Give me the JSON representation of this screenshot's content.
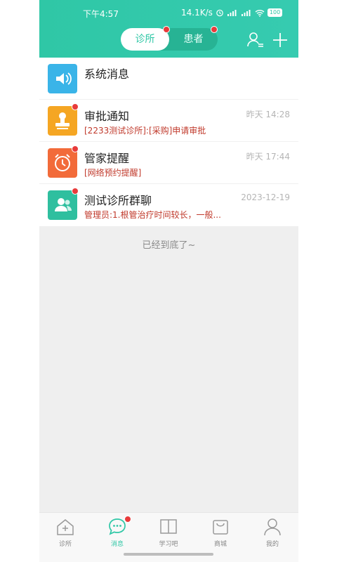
{
  "status": {
    "time": "下午4:57",
    "speed": "14.1K/s",
    "battery": "100"
  },
  "header": {
    "tabs": [
      {
        "label": "诊所",
        "active": true,
        "badge": true
      },
      {
        "label": "患者",
        "active": false,
        "badge": true
      }
    ],
    "icons": [
      "user-list-icon",
      "plus-icon"
    ],
    "accent": "#2fc7a6"
  },
  "messages": [
    {
      "title": "系统消息",
      "subtitle": "",
      "time": "",
      "icon": "speaker-icon",
      "color": "#3ab4e8",
      "badge": false
    },
    {
      "title": "审批通知",
      "subtitle": "[2233测试诊所]:[采购]申请审批",
      "time": "昨天 14:28",
      "icon": "stamp-icon",
      "color": "#f5a623",
      "badge": true
    },
    {
      "title": "管家提醒",
      "subtitle": "[网络预约提醒]",
      "time": "昨天 17:44",
      "icon": "alarm-clock-icon",
      "color": "#f26b3a",
      "badge": true
    },
    {
      "title": "测试诊所群聊",
      "subtitle": "管理员:1.根管治疗时间较长，一般...",
      "time": "2023-12-19",
      "icon": "group-icon",
      "color": "#2fbf9f",
      "badge": true
    }
  ],
  "end_text": "已经到底了~",
  "tabbar": [
    {
      "label": "诊所",
      "icon": "clinic-icon",
      "active": false
    },
    {
      "label": "消息",
      "icon": "chat-bubble-icon",
      "active": true,
      "badge": true
    },
    {
      "label": "学习吧",
      "icon": "book-icon",
      "active": false
    },
    {
      "label": "商城",
      "icon": "shopping-bag-icon",
      "active": false
    },
    {
      "label": "我的",
      "icon": "person-icon",
      "active": false
    }
  ]
}
